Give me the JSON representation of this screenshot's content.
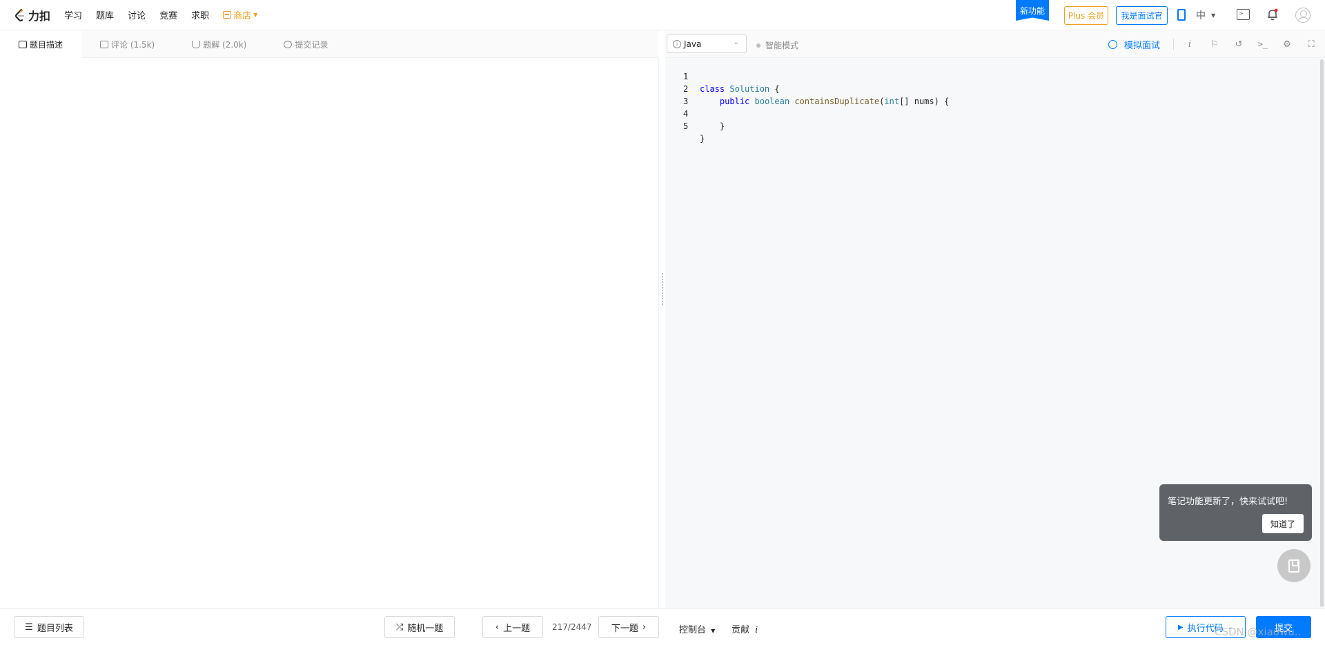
{
  "brand": {
    "name": "力扣"
  },
  "nav": {
    "links": [
      "学习",
      "题库",
      "讨论",
      "竞赛",
      "求职"
    ],
    "store": "商店"
  },
  "header": {
    "new_feature": "新功能",
    "plus": "Plus 会员",
    "interviewer": "我是面试官",
    "language": "中"
  },
  "left_tabs": [
    {
      "label": "题目描述",
      "icon": "description-icon"
    },
    {
      "label": "评论 (1.5k)",
      "icon": "comment-icon"
    },
    {
      "label": "题解 (2.0k)",
      "icon": "flask-icon"
    },
    {
      "label": "提交记录",
      "icon": "clock-icon"
    }
  ],
  "editor_toolbar": {
    "language": "Java",
    "smart_mode": "智能模式",
    "mock_interview": "模拟面试",
    "icons": [
      "info-italic-icon",
      "flag-icon",
      "reset-icon",
      "terminal-icon",
      "settings-icon",
      "fullscreen-icon"
    ]
  },
  "code": {
    "lines": [
      {
        "n": "1"
      },
      {
        "n": "2"
      },
      {
        "n": "3"
      },
      {
        "n": "4"
      },
      {
        "n": "5"
      }
    ],
    "tokens": {
      "class_kw": "class",
      "class_name": "Solution",
      "brace_open": " {",
      "public_kw": "public",
      "boolean_kw": "boolean",
      "method": "containsDuplicate",
      "paren_open": "(",
      "int_kw": "int",
      "params": "[] nums) {",
      "close_inner": "}",
      "close_outer": "}"
    }
  },
  "tooltip": {
    "text": "笔记功能更新了，快来试试吧!",
    "button": "知道了"
  },
  "bottom": {
    "problem_list": "题目列表",
    "random": "随机一题",
    "prev": "上一题",
    "page": "217/2447",
    "next": "下一题",
    "console": "控制台",
    "contribute": "贡献",
    "run": "执行代码",
    "submit": "提交",
    "watermark": "CSDN @xiaowu.."
  },
  "colors": {
    "accent": "#007aff",
    "store": "#f0a020"
  }
}
